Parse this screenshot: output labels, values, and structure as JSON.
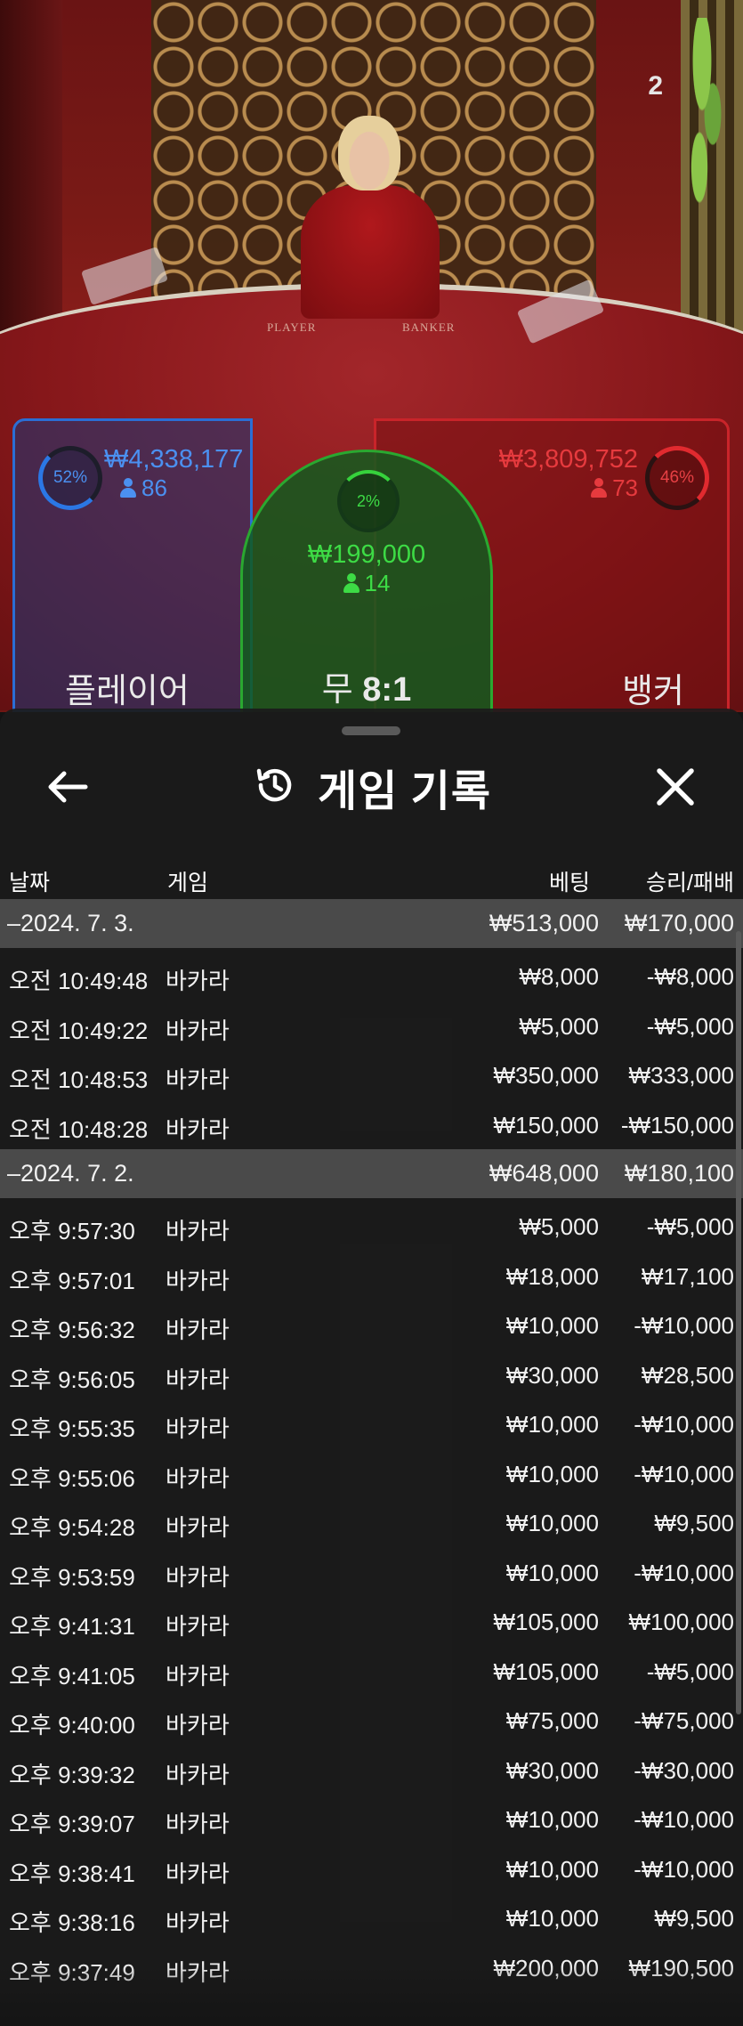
{
  "live": {
    "counter": "2",
    "table_words": [
      "PLAYER",
      "BANKER"
    ]
  },
  "betting": {
    "player": {
      "percent": "52%",
      "amount": "₩4,338,177",
      "count": "86",
      "label": "플레이어",
      "color": "#2b77e4"
    },
    "tie": {
      "percent": "2%",
      "amount": "₩199,000",
      "count": "14",
      "label_prefix": "무",
      "payout": "8:1",
      "color": "#36d23c"
    },
    "banker": {
      "percent": "46%",
      "amount": "₩3,809,752",
      "count": "73",
      "label": "뱅커",
      "color": "#e12a2f"
    }
  },
  "history": {
    "back_icon": "arrow-left-icon",
    "history_icon": "history-clock-icon",
    "close_icon": "close-x-icon",
    "title": "게임 기록",
    "columns": {
      "date": "날짜",
      "game": "게임",
      "bet": "베팅",
      "result": "승리/패배"
    },
    "days": [
      {
        "date": "–2024. 7. 3.",
        "total_bet": "₩513,000",
        "total_result": "₩170,000",
        "rows": [
          {
            "time": "오전 10:49:48",
            "game": "바카라",
            "bet": "₩8,000",
            "result": "-₩8,000"
          },
          {
            "time": "오전 10:49:22",
            "game": "바카라",
            "bet": "₩5,000",
            "result": "-₩5,000"
          },
          {
            "time": "오전 10:48:53",
            "game": "바카라",
            "bet": "₩350,000",
            "result": "₩333,000"
          },
          {
            "time": "오전 10:48:28",
            "game": "바카라",
            "bet": "₩150,000",
            "result": "-₩150,000"
          }
        ]
      },
      {
        "date": "–2024. 7. 2.",
        "total_bet": "₩648,000",
        "total_result": "₩180,100",
        "rows": [
          {
            "time": "오후 9:57:30",
            "game": "바카라",
            "bet": "₩5,000",
            "result": "-₩5,000"
          },
          {
            "time": "오후 9:57:01",
            "game": "바카라",
            "bet": "₩18,000",
            "result": "₩17,100"
          },
          {
            "time": "오후 9:56:32",
            "game": "바카라",
            "bet": "₩10,000",
            "result": "-₩10,000"
          },
          {
            "time": "오후 9:56:05",
            "game": "바카라",
            "bet": "₩30,000",
            "result": "₩28,500"
          },
          {
            "time": "오후 9:55:35",
            "game": "바카라",
            "bet": "₩10,000",
            "result": "-₩10,000"
          },
          {
            "time": "오후 9:55:06",
            "game": "바카라",
            "bet": "₩10,000",
            "result": "-₩10,000"
          },
          {
            "time": "오후 9:54:28",
            "game": "바카라",
            "bet": "₩10,000",
            "result": "₩9,500"
          },
          {
            "time": "오후 9:53:59",
            "game": "바카라",
            "bet": "₩10,000",
            "result": "-₩10,000"
          },
          {
            "time": "오후 9:41:31",
            "game": "바카라",
            "bet": "₩105,000",
            "result": "₩100,000"
          },
          {
            "time": "오후 9:41:05",
            "game": "바카라",
            "bet": "₩105,000",
            "result": "-₩5,000"
          },
          {
            "time": "오후 9:40:00",
            "game": "바카라",
            "bet": "₩75,000",
            "result": "-₩75,000"
          },
          {
            "time": "오후 9:39:32",
            "game": "바카라",
            "bet": "₩30,000",
            "result": "-₩30,000"
          },
          {
            "time": "오후 9:39:07",
            "game": "바카라",
            "bet": "₩10,000",
            "result": "-₩10,000"
          },
          {
            "time": "오후 9:38:41",
            "game": "바카라",
            "bet": "₩10,000",
            "result": "-₩10,000"
          },
          {
            "time": "오후 9:38:16",
            "game": "바카라",
            "bet": "₩10,000",
            "result": "₩9,500"
          },
          {
            "time": "오후 9:37:49",
            "game": "바카라",
            "bet": "₩200,000",
            "result": "₩190,500"
          }
        ]
      }
    ]
  }
}
